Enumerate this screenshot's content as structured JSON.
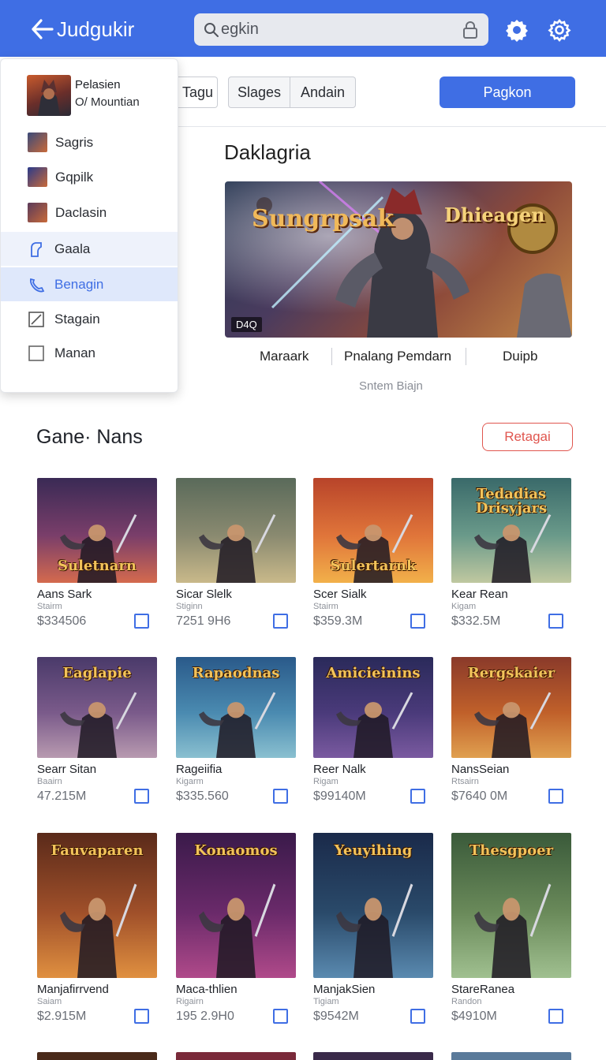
{
  "header": {
    "title": "Judgukir",
    "search_text": "egkin"
  },
  "toolbar": {
    "tabs": [
      "Tagu",
      "Slages",
      "Andain"
    ],
    "primary_label": "Pagkon"
  },
  "featured": {
    "title": "Daklagria",
    "hero_left": "Sungrpsak",
    "hero_right": "Dhieagen",
    "hero_badge": "D4Q",
    "meta": [
      "Maraark",
      "Pnalang Pemdarn",
      "Duipb"
    ],
    "note": "Sntem Biajn"
  },
  "section": {
    "title": "Gane· Nans",
    "button": "Retagai"
  },
  "games": [
    {
      "name": "Aans Sark",
      "sub": "Stairm",
      "price": "$334506",
      "art": "Suletnarn",
      "palette": [
        "#3a2a55",
        "#7a3e6a",
        "#d46a4e"
      ]
    },
    {
      "name": "Sicar Slelk",
      "sub": "Stiginn",
      "price": "7251 9H6",
      "art": "",
      "palette": [
        "#5a6a5a",
        "#8a8a70",
        "#c9b98a"
      ]
    },
    {
      "name": "Scer Sialk",
      "sub": "Stairm",
      "price": "$359.3M",
      "art": "Sulertarnk",
      "palette": [
        "#b8442a",
        "#e0753a",
        "#f2b04a"
      ]
    },
    {
      "name": "Kear Rean",
      "sub": "Kigam",
      "price": "$332.5M",
      "art": "Tedadias Drisyjars",
      "palette": [
        "#3a6a6a",
        "#6a9a8a",
        "#c0c8a0"
      ]
    },
    {
      "name": "Searr Sitan",
      "sub": "Baairn",
      "price": "47.215M",
      "art": "Eaglapie",
      "palette": [
        "#4a3a6a",
        "#7a5a8a",
        "#b89ab0"
      ]
    },
    {
      "name": "Rageiifia",
      "sub": "Kigarm",
      "price": "$335.560",
      "art": "Rapaodnas",
      "palette": [
        "#2a5a8a",
        "#4a8ab0",
        "#8ac0d0"
      ]
    },
    {
      "name": "Reer Nalk",
      "sub": "Rigam",
      "price": "$99140M",
      "art": "Amicieinins",
      "palette": [
        "#2a2a5a",
        "#4a3a7a",
        "#7a5aa0"
      ]
    },
    {
      "name": "NansSeian",
      "sub": "Rtsairn",
      "price": "$7640 0M",
      "art": "Rergskaier",
      "palette": [
        "#8a3a2a",
        "#c0602a",
        "#e0a050"
      ]
    },
    {
      "name": "Manjafirrvend",
      "sub": "Saiam",
      "price": "$2.915M",
      "art": "Fauvaparen",
      "palette": [
        "#5a2a1a",
        "#a0502a",
        "#e09040"
      ]
    },
    {
      "name": "Maca-thlien",
      "sub": "Rigairn",
      "price": "195 2.9H0",
      "art": "Konaomos",
      "palette": [
        "#3a1a4a",
        "#6a2a6a",
        "#b04a8a"
      ]
    },
    {
      "name": "ManjakSien",
      "sub": "Tigiam",
      "price": "$9542M",
      "art": "Yeuyihing",
      "palette": [
        "#1a2a4a",
        "#2a4a6a",
        "#5a8ab0"
      ]
    },
    {
      "name": "StareRanea",
      "sub": "Randon",
      "price": "$4910M",
      "art": "Thesgpoer",
      "palette": [
        "#3a5a3a",
        "#6a8a5a",
        "#a0c090"
      ]
    }
  ],
  "dropdown": {
    "profile_name": "Pelasien",
    "profile_sub": "O/ Mountian",
    "items": [
      {
        "label": "Sagris",
        "kind": "thumb",
        "color": "#3a4a7a"
      },
      {
        "label": "Gqpilk",
        "kind": "thumb",
        "color": "#2a3a8a"
      },
      {
        "label": "Daclasin",
        "kind": "thumb",
        "color": "#5a3a5a"
      },
      {
        "label": "Gaala",
        "kind": "icon",
        "icon": "bookmark-icon"
      },
      {
        "label": "Benagin",
        "kind": "icon",
        "icon": "phone-icon",
        "selected": true
      },
      {
        "label": "Stagain",
        "kind": "icon",
        "icon": "checkbox-checked-icon"
      },
      {
        "label": "Manan",
        "kind": "icon",
        "icon": "checkbox-empty-icon"
      }
    ]
  },
  "colors": {
    "brand": "#3f6ee4",
    "accent_red": "#e0564f",
    "selected_bg": "#dfe8fb",
    "hover_bg": "#eef2fb"
  }
}
